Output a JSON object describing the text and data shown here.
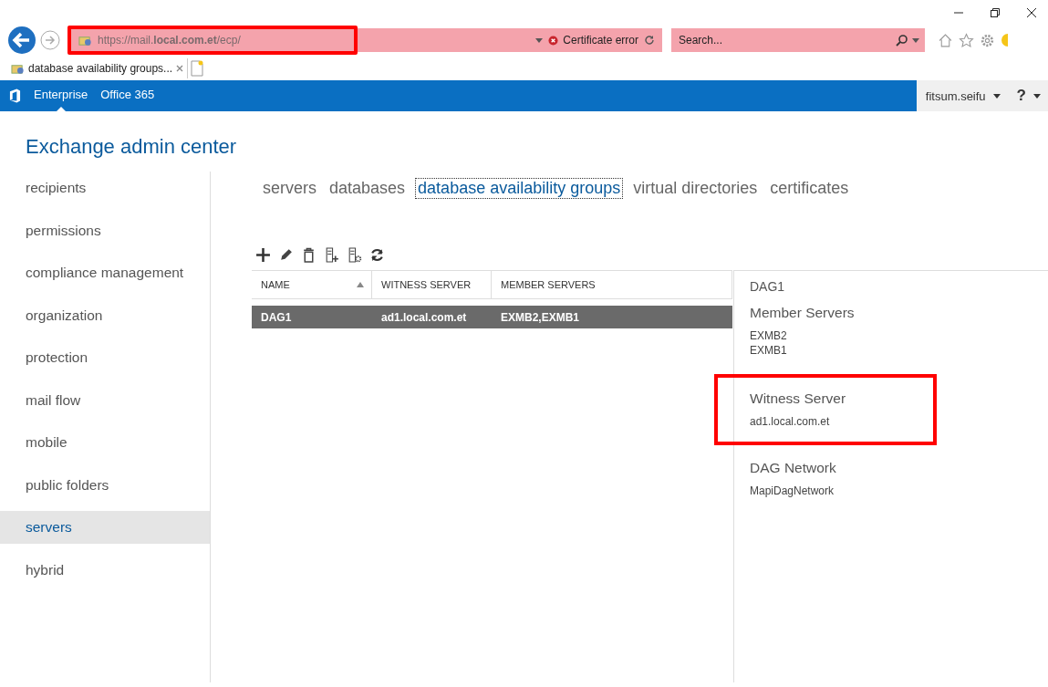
{
  "browser": {
    "address": "https://mail.**local.com.et**/ecp/",
    "address_highlighted": true,
    "certificate": "Certificate error",
    "search": {
      "placeholder": "Search..."
    },
    "tab_title": "database availability groups..."
  },
  "app_bar": {
    "items": [
      {
        "label": "Enterprise",
        "selected": true
      },
      {
        "label": "Office 365",
        "selected": false
      }
    ],
    "user": "fitsum.seifu",
    "help": "?"
  },
  "title": "Exchange admin center",
  "sidebar": {
    "items": [
      {
        "label": "recipients",
        "selected": false
      },
      {
        "label": "permissions",
        "selected": false
      },
      {
        "label": "compliance management",
        "selected": false
      },
      {
        "label": "organization",
        "selected": false
      },
      {
        "label": "protection",
        "selected": false
      },
      {
        "label": "mail flow",
        "selected": false
      },
      {
        "label": "mobile",
        "selected": false
      },
      {
        "label": "public folders",
        "selected": false
      },
      {
        "label": "servers",
        "selected": true
      },
      {
        "label": "hybrid",
        "selected": false
      }
    ]
  },
  "tabs": [
    {
      "label": "servers",
      "selected": false
    },
    {
      "label": "databases",
      "selected": false
    },
    {
      "label": "database availability groups",
      "selected": true
    },
    {
      "label": "virtual directories",
      "selected": false
    },
    {
      "label": "certificates",
      "selected": false
    }
  ],
  "table": {
    "columns": [
      {
        "label": "NAME",
        "sorted": true
      },
      {
        "label": "WITNESS SERVER",
        "sorted": false
      },
      {
        "label": "MEMBER SERVERS",
        "sorted": false
      }
    ],
    "rows": [
      {
        "cells": [
          "DAG1",
          "ad1.local.com.et",
          "EXMB2,EXMB1"
        ],
        "selected": true
      }
    ]
  },
  "details": {
    "title": "DAG1",
    "sections": [
      {
        "heading": "Member Servers",
        "values": [
          "EXMB2",
          "EXMB1"
        ],
        "highlighted": false
      },
      {
        "heading": "Witness Server",
        "values": [
          "ad1.local.com.et"
        ],
        "highlighted": true
      },
      {
        "heading": "DAG Network",
        "values": [
          "MapiDagNetwork"
        ],
        "highlighted": false
      }
    ]
  }
}
